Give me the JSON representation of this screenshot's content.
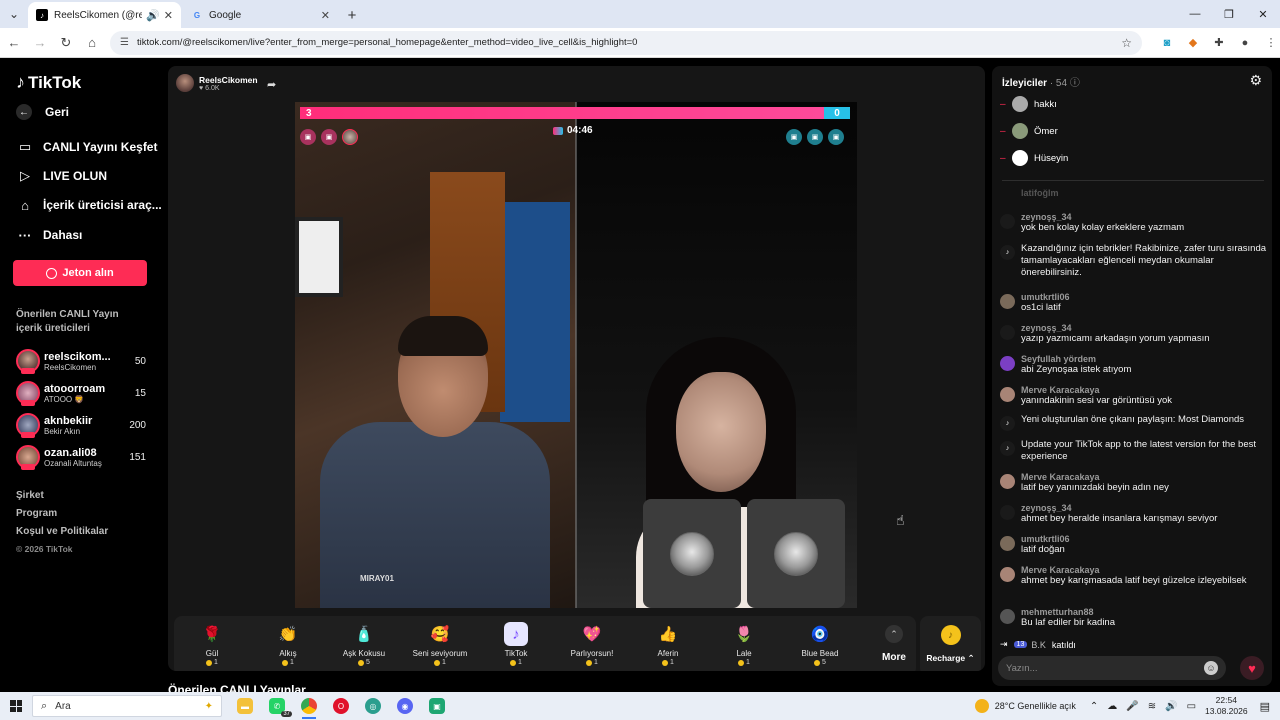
{
  "browser": {
    "tabs": [
      {
        "label": "ReelsCikomen (@reelscikom",
        "active": true
      },
      {
        "label": "Google",
        "active": false
      }
    ],
    "url": "tiktok.com/@reelscikomen/live?enter_from_merge=personal_homepage&enter_method=video_live_cell&is_highlight=0"
  },
  "nav": {
    "logo": "TikTok",
    "back": "Geri",
    "items": [
      "CANLI Yayını Keşfet",
      "LIVE OLUN",
      "İçerik üreticisi araç...",
      "Dahası"
    ],
    "coin_button": "Jeton alın",
    "suggested_title": "Önerilen CANLI Yayın içerik üreticileri",
    "creators": [
      {
        "name": "reelscikom...",
        "sub": "ReelsCikomen",
        "count": "50"
      },
      {
        "name": "atooorroam",
        "sub": "ATOOO 🦁",
        "count": "15"
      },
      {
        "name": "aknbekiir",
        "sub": "Bekir Akın",
        "count": "200"
      },
      {
        "name": "ozan.ali08",
        "sub": "Ozanali Altuntaş",
        "count": "151"
      }
    ],
    "footer": [
      "Şirket",
      "Program",
      "Koşul ve Politikalar"
    ],
    "copyright": "© 2026 TikTok"
  },
  "live": {
    "host_name": "ReelsCikomen",
    "host_likes": "6.0K",
    "pk_left": "3",
    "pk_right": "0",
    "timer": "04:46",
    "watermark": "MIRAY01",
    "gifts": [
      {
        "name": "Gül",
        "price": "1",
        "icon": "🌹"
      },
      {
        "name": "Alkış",
        "price": "1",
        "icon": "👏"
      },
      {
        "name": "Aşk Kokusu",
        "price": "5",
        "icon": "🧴"
      },
      {
        "name": "Seni seviyorum",
        "price": "1",
        "icon": "🥰"
      },
      {
        "name": "TikTok",
        "price": "1",
        "icon": "♪"
      },
      {
        "name": "Parlıyorsun!",
        "price": "1",
        "icon": "💖"
      },
      {
        "name": "Aferin",
        "price": "1",
        "icon": "👍"
      },
      {
        "name": "Lale",
        "price": "1",
        "icon": "🌷"
      },
      {
        "name": "Blue Bead",
        "price": "5",
        "icon": "🧿"
      }
    ],
    "more_label": "More",
    "recharge_label": "Recharge ⌃",
    "suggested_heading": "Önerilen CANLI Yayınlar"
  },
  "chat": {
    "viewers_label": "İzleyiciler",
    "viewers_count": "· 54",
    "viewers": [
      "hakkı",
      "Ömer",
      "Hüseyin"
    ],
    "faded_user": "latifoğlm",
    "messages": [
      {
        "user": "zeynoşş_34",
        "text": "yok ben kolay kolay erkeklere yazmam",
        "avatar": "#1a1a1a"
      },
      {
        "user": "",
        "text": "Kazandığınız için tebrikler! Rakibinize, zafer turu sırasında tamamlayacakları eğlenceli meydan okumalar önerebilirsiniz.",
        "avatar": "tiktok"
      },
      {
        "user": "umutkrtli06",
        "text": "os1ci latif",
        "avatar": "#7a6a5a"
      },
      {
        "user": "zeynoşş_34",
        "text": "yazıp yazmıcamı arkadaşın yorum yapmasın",
        "avatar": "#1a1a1a"
      },
      {
        "user": "Seyfullah yördem",
        "text": "abi Zeynoşaa istek atıyom",
        "avatar": "#7b3fc4"
      },
      {
        "user": "Merve Karacakaya",
        "text": "yanındakinin sesi var görüntüsü yok",
        "avatar": "#a88476"
      },
      {
        "user": "",
        "text": "Yeni oluşturulan öne çıkanı paylaşın: Most Diamonds",
        "avatar": "tiktok"
      },
      {
        "user": "",
        "text": "Update your TikTok app to the latest version for the best experience",
        "avatar": "tiktok"
      },
      {
        "user": "Merve Karacakaya",
        "text": "latif bey yanınızdaki beyin adın ney",
        "avatar": "#a88476"
      },
      {
        "user": "zeynoşş_34",
        "text": "ahmet bey heralde insanlara karışmayı seviyor",
        "avatar": "#1a1a1a"
      },
      {
        "user": "umutkrtli06",
        "text": "latif doğan",
        "avatar": "#7a6a5a"
      },
      {
        "user": "Merve Karacakaya",
        "text": "ahmet bey karışmasada latif beyi güzelce izleyebilsek",
        "avatar": "#a88476"
      },
      {
        "user": "mehmetturhan88",
        "text": "Bu laf ediler bir kadina",
        "avatar": "#555"
      }
    ],
    "join_badge": "13",
    "join_user": "B.K",
    "join_text": "katıldı",
    "input_placeholder": "Yazın..."
  },
  "taskbar": {
    "search": "Ara",
    "whatsapp_badge": "37",
    "weather": "28°C  Genellikle açık",
    "time": "22:54",
    "date": "13.08.2026"
  }
}
